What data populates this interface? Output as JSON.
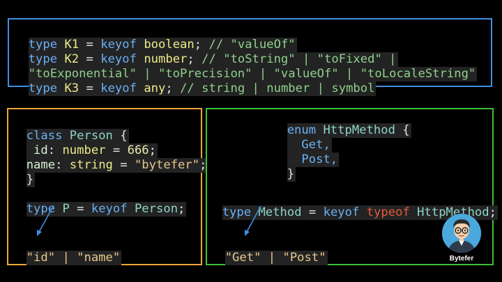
{
  "top_panel": {
    "line1": {
      "t1": "type",
      "t2": " K1 ",
      "t3": "= ",
      "t4": "keyof",
      "t5": " boolean",
      "t6": "; ",
      "t7": "// \"valueOf\""
    },
    "line2": {
      "t1": "type",
      "t2": " K2 ",
      "t3": "= ",
      "t4": "keyof",
      "t5": " number",
      "t6": "; ",
      "t7": "// \"toString\" | \"toFixed\" |"
    },
    "line3": {
      "t1": "\"toExponential\" | \"toPrecision\" | \"valueOf\" | \"toLocaleString\""
    },
    "line4": {
      "t1": "type",
      "t2": " K3 ",
      "t3": "= ",
      "t4": "keyof",
      "t5": " any",
      "t6": "; ",
      "t7": "// string | number | symbol"
    }
  },
  "left_panel": {
    "class_line": {
      "kw": "class",
      "name": " Person ",
      "brace": "{"
    },
    "id_line": {
      "prop": " id",
      "colon": ": ",
      "type": "number",
      "eq": " = ",
      "value": "666",
      "semi": ";"
    },
    "name_line": {
      "prop": "name",
      "colon": ": ",
      "type": "string",
      "eq": " = ",
      "value": "\"bytefer\"",
      "semi": ";"
    },
    "close_line": "}",
    "type_line": {
      "kw": "type",
      "name": " P ",
      "eq": "= ",
      "keyof": "keyof",
      "target": " Person",
      "semi": ";"
    },
    "result": "\"id\" | \"name\""
  },
  "right_panel": {
    "enum_line": {
      "kw": "enum",
      "name": " HttpMethod ",
      "brace": "{"
    },
    "get_line": "  Get,",
    "post_line": "  Post,",
    "close_line": "}",
    "type_line": {
      "kw": "type",
      "name": " Method ",
      "eq": "= ",
      "keyof": "keyof",
      "typeof": " typeof",
      "target": " HttpMethod",
      "semi": ";"
    },
    "result": "\"Get\" | \"Post\""
  },
  "branding": {
    "name": "Bytefer"
  },
  "colors": {
    "top_border": "#3f8fe0",
    "left_border": "#f0a63a",
    "right_border": "#3fbf35",
    "keyword": "#6ab0f5",
    "typeof": "#e45a3b",
    "comment": "#8fd18c"
  }
}
